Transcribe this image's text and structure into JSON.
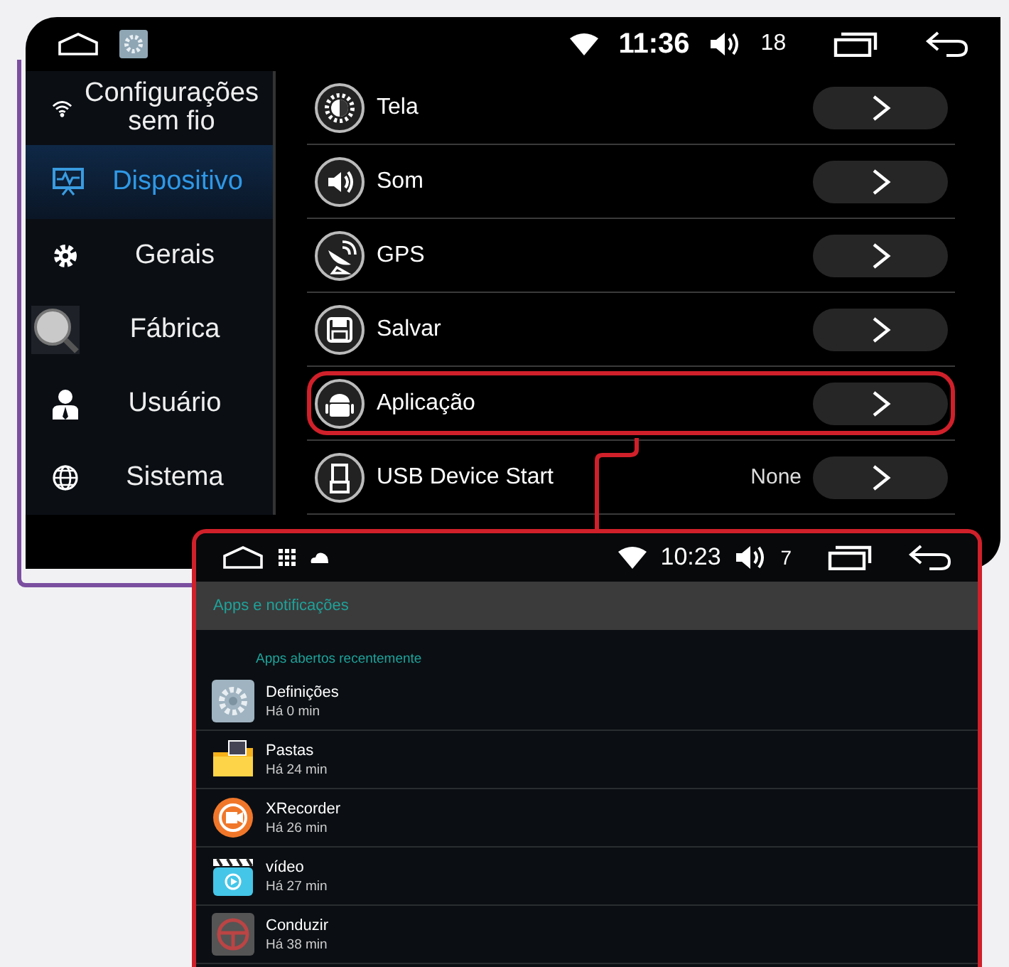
{
  "device_screen": {
    "status_bar": {
      "time": "11:36",
      "volume": "18"
    },
    "sidebar": {
      "items": [
        {
          "label": "Configurações sem fio",
          "selected": false
        },
        {
          "label": "Dispositivo",
          "selected": true
        },
        {
          "label": "Gerais",
          "selected": false
        },
        {
          "label": "Fábrica",
          "selected": false
        },
        {
          "label": "Usuário",
          "selected": false
        },
        {
          "label": "Sistema",
          "selected": false
        }
      ]
    },
    "menu": {
      "items": [
        {
          "label": "Tela",
          "highlighted": false
        },
        {
          "label": "Som",
          "highlighted": false
        },
        {
          "label": "GPS",
          "highlighted": false
        },
        {
          "label": "Salvar",
          "highlighted": false
        },
        {
          "label": "Aplicação",
          "highlighted": true
        },
        {
          "label": "USB Device Start",
          "value": "None",
          "highlighted": false
        }
      ]
    }
  },
  "apps_screen": {
    "status_bar": {
      "time": "10:23",
      "volume": "7"
    },
    "title": "Apps e notificações",
    "section": "Apps abertos recentemente",
    "apps": [
      {
        "name": "Definições",
        "time": "Há 0 min"
      },
      {
        "name": "Pastas",
        "time": "Há 24 min"
      },
      {
        "name": "XRecorder",
        "time": "Há 26 min"
      },
      {
        "name": "vídeo",
        "time": "Há 27 min"
      },
      {
        "name": "Conduzir",
        "time": "Há 38 min"
      }
    ]
  }
}
